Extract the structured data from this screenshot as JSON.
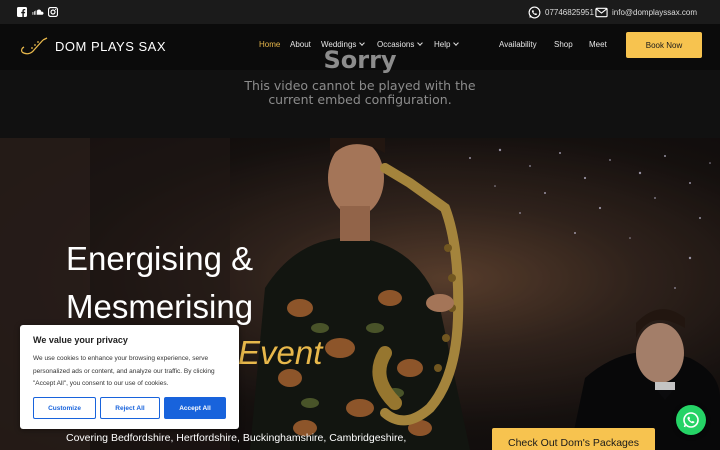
{
  "topbar": {
    "social_icons": [
      "facebook-icon",
      "soundcloud-icon",
      "instagram-icon"
    ],
    "phone": "07746825951",
    "email": "info@domplayssax.com"
  },
  "header": {
    "logo_text": "DOM PLAYS SAX",
    "nav": [
      {
        "label": "Home",
        "active": true
      },
      {
        "label": "About"
      },
      {
        "label": "Weddings",
        "dropdown": true
      },
      {
        "label": "Occasions",
        "dropdown": true
      },
      {
        "label": "Help",
        "dropdown": true
      },
      {
        "label": "Availability"
      },
      {
        "label": "Shop"
      },
      {
        "label": "Meet"
      }
    ],
    "book_label": "Book Now"
  },
  "video": {
    "title": "Sorry",
    "message": "This video cannot be played with the current embed configuration."
  },
  "hero": {
    "line1": "Energising &",
    "line2": "Mesmerising",
    "line3": "Event",
    "covering": "Covering Bedfordshire, Hertfordshire, Buckinghamshire, Cambridgeshire,",
    "packages_label": "Check Out Dom's Packages"
  },
  "cookie": {
    "title": "We value your privacy",
    "text": "We use cookies to enhance your browsing experience, serve personalized ads or content, and analyze our traffic. By clicking \"Accept All\", you consent to our use of cookies.",
    "customize": "Customize",
    "reject": "Reject All",
    "accept": "Accept All"
  },
  "colors": {
    "accent": "#f7c34f",
    "gold_text": "#e8b84b",
    "cookie_blue": "#1863dc",
    "whatsapp": "#25d366"
  }
}
